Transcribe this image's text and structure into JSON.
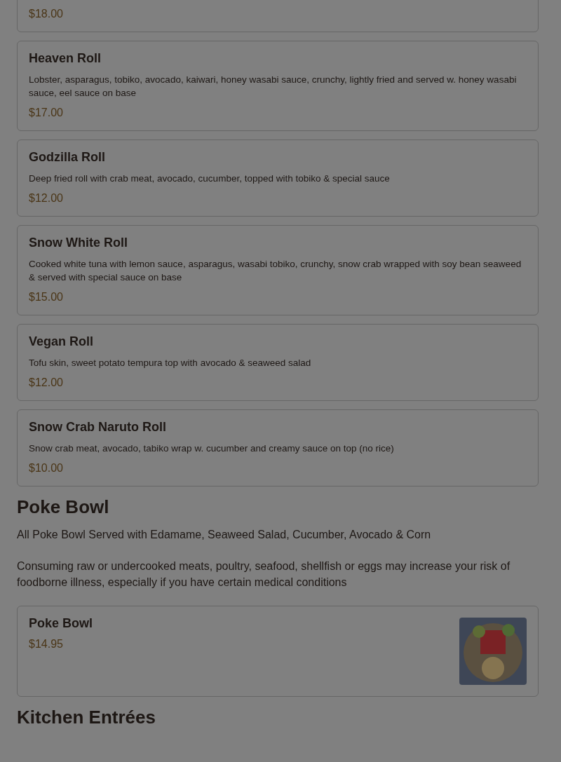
{
  "sections": [
    {
      "items": [
        {
          "kind": "cut-off",
          "price": "$18.00"
        }
      ]
    },
    {
      "items": [
        {
          "kind": "plain",
          "name": "Heaven Roll",
          "description": "Lobster, asparagus, tobiko, avocado, kaiwari, honey wasabi sauce, crunchy, lightly fried and served w. honey wasabi sauce, eel sauce on base",
          "price": "$17.00"
        },
        {
          "kind": "plain",
          "name": "Godzilla Roll",
          "description": "Deep fried roll with crab meat, avocado, cucumber, topped with tobiko & special sauce",
          "price": "$12.00"
        },
        {
          "kind": "plain",
          "name": "Snow White Roll",
          "description": "Cooked white tuna with lemon sauce, asparagus, wasabi tobiko, crunchy, snow crab wrapped with soy bean seaweed & served with special sauce on base",
          "price": "$15.00"
        },
        {
          "kind": "plain",
          "name": "Vegan Roll",
          "description": "Tofu skin, sweet potato tempura top with avocado & seaweed salad",
          "price": "$12.00"
        },
        {
          "kind": "plain",
          "name": "Snow Crab Naruto Roll",
          "description": "Snow crab meat, avocado, tabiko wrap w. cucumber and creamy sauce on top (no rice)",
          "price": "$10.00"
        }
      ]
    },
    {
      "title": "Poke Bowl",
      "notes": [
        "All Poke Bowl Served with Edamame, Seaweed Salad, Cucumber, Avocado & Corn",
        "Consuming raw or undercooked meats, poultry, seafood, shellfish or eggs may increase your risk of foodborne illness, especially if you have certain medical conditions"
      ],
      "items": [
        {
          "kind": "with-photo",
          "name": "Poke Bowl",
          "price": "$14.95"
        }
      ]
    },
    {
      "title": "Kitchen Entrées"
    }
  ]
}
